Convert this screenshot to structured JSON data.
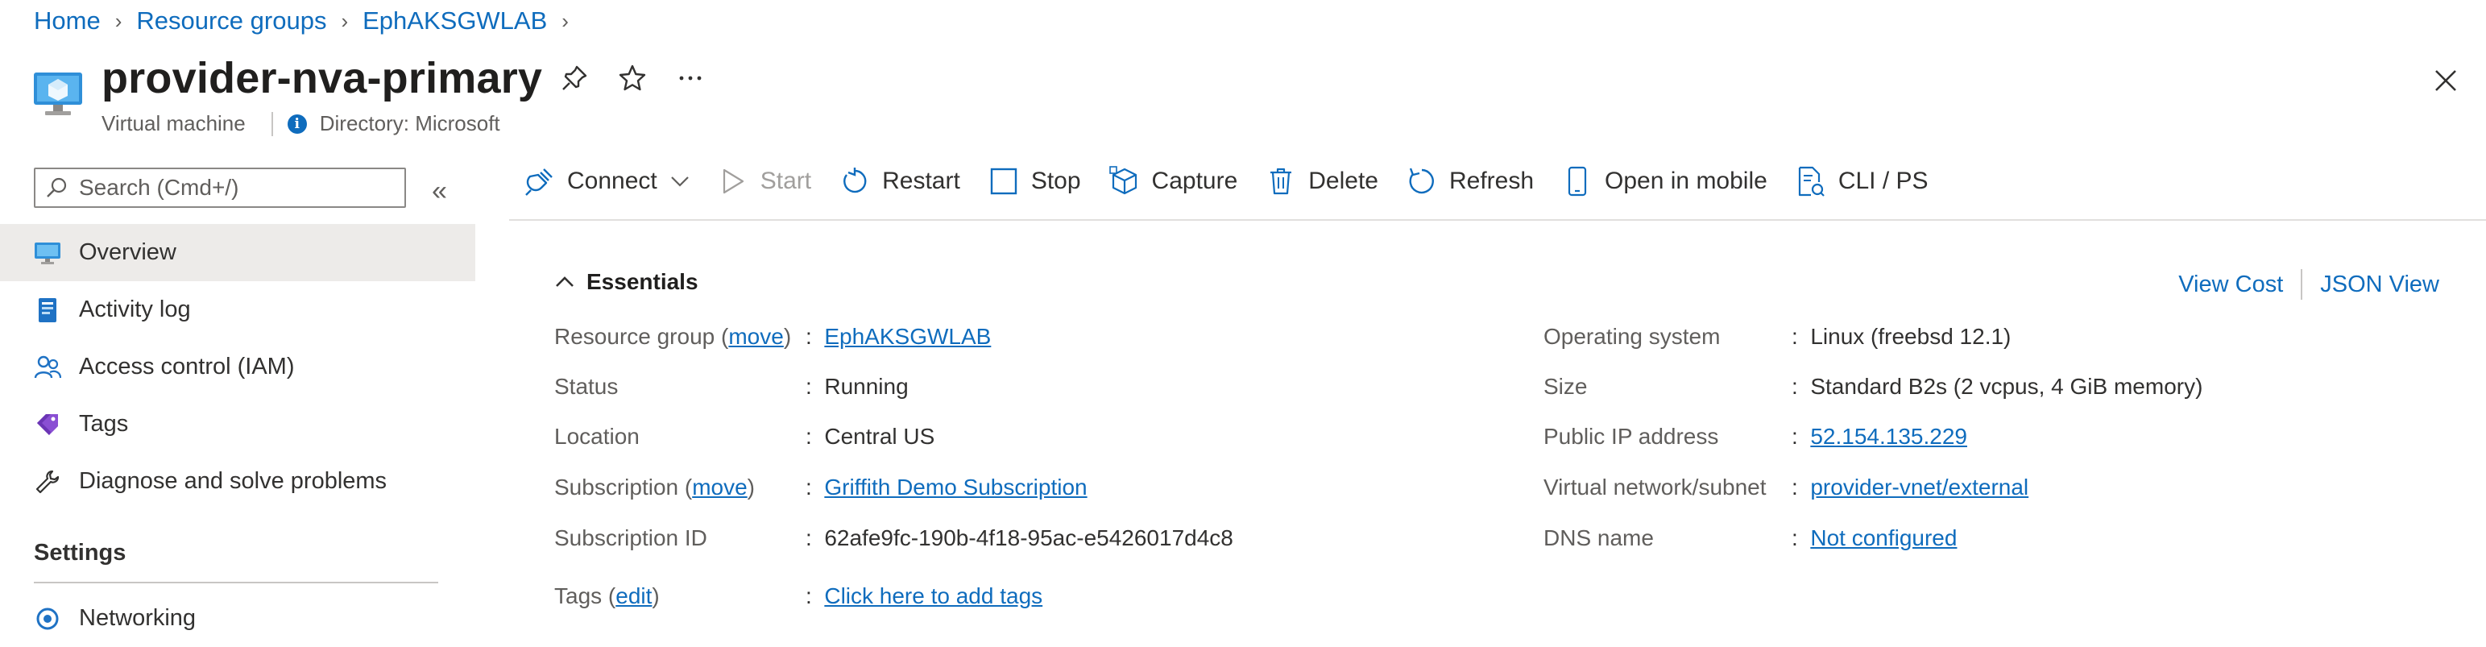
{
  "breadcrumb": {
    "items": [
      "Home",
      "Resource groups",
      "EphAKSGWLAB"
    ]
  },
  "header": {
    "title": "provider-nva-primary",
    "resource_type": "Virtual machine",
    "directory": "Directory: Microsoft",
    "actions": [
      "pin-icon",
      "star-icon",
      "more-icon"
    ]
  },
  "sidebar": {
    "search_placeholder": "Search (Cmd+/)",
    "collapse_glyph": "«",
    "items": [
      {
        "label": "Overview",
        "icon": "vm-monitor-icon",
        "active": true
      },
      {
        "label": "Activity log",
        "icon": "activity-log-icon"
      },
      {
        "label": "Access control (IAM)",
        "icon": "people-icon"
      },
      {
        "label": "Tags",
        "icon": "tag-icon"
      },
      {
        "label": "Diagnose and solve problems",
        "icon": "wrench-icon"
      }
    ],
    "settings_header": "Settings",
    "settings_items": [
      {
        "label": "Networking",
        "icon": "networking-icon"
      }
    ]
  },
  "toolbar": {
    "connect": "Connect",
    "start": "Start",
    "restart": "Restart",
    "stop": "Stop",
    "capture": "Capture",
    "delete": "Delete",
    "refresh": "Refresh",
    "open_in_mobile": "Open in mobile",
    "cli_ps": "CLI / PS"
  },
  "essentials": {
    "header": "Essentials",
    "view_cost": "View Cost",
    "json_view": "JSON View",
    "left": {
      "resource_group_label": "Resource group",
      "move1": "move",
      "resource_group_value": "EphAKSGWLAB",
      "status_label": "Status",
      "status_value": "Running",
      "location_label": "Location",
      "location_value": "Central US",
      "subscription_label": "Subscription",
      "move2": "move",
      "subscription_value": "Griffith Demo Subscription",
      "subscription_id_label": "Subscription ID",
      "subscription_id_value": "62afe9fc-190b-4f18-95ac-e5426017d4c8",
      "tags_label": "Tags",
      "edit": "edit",
      "tags_value": "Click here to add tags"
    },
    "right": {
      "os_label": "Operating system",
      "os_value": "Linux (freebsd 12.1)",
      "size_label": "Size",
      "size_value": "Standard B2s (2 vcpus, 4 GiB memory)",
      "public_ip_label": "Public IP address",
      "public_ip_value": "52.154.135.229",
      "vnet_label": "Virtual network/subnet",
      "vnet_value": "provider-vnet/external",
      "dns_label": "DNS name",
      "dns_value": "Not configured"
    }
  },
  "colors": {
    "accent": "#0f6cbd",
    "selected_bg": "#edebe9",
    "text": "#323130",
    "muted": "#605e5c"
  }
}
